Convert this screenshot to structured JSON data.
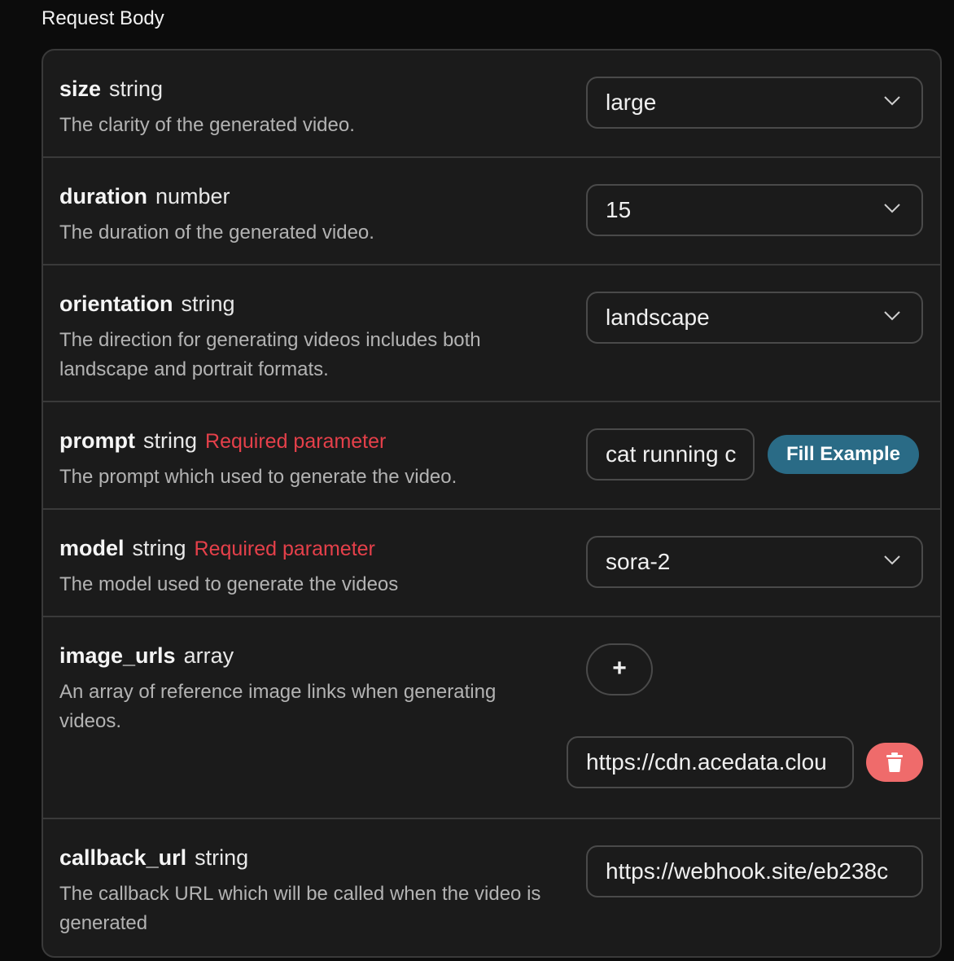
{
  "section_title": "Request Body",
  "colors": {
    "required": "#e5404a",
    "fill_button": "#2a6b86",
    "delete_button": "#ef6b6b"
  },
  "params": [
    {
      "name": "size",
      "type": "string",
      "required_label": "",
      "description": "The clarity of the generated video.",
      "control": "select",
      "value": "large",
      "icon": "chevron-down-icon"
    },
    {
      "name": "duration",
      "type": "number",
      "required_label": "",
      "description": "The duration of the generated video.",
      "control": "select",
      "value": "15",
      "icon": "chevron-down-icon"
    },
    {
      "name": "orientation",
      "type": "string",
      "required_label": "",
      "description": "The direction for generating videos includes both landscape and portrait formats.",
      "control": "select",
      "value": "landscape",
      "icon": "chevron-down-icon"
    },
    {
      "name": "prompt",
      "type": "string",
      "required_label": "Required parameter",
      "description": "The prompt which used to generate the video.",
      "control": "text",
      "value": "cat running c",
      "fill_button_label": "Fill Example"
    },
    {
      "name": "model",
      "type": "string",
      "required_label": "Required parameter",
      "description": "The model used to generate the videos",
      "control": "select",
      "value": "sora-2",
      "icon": "chevron-down-icon"
    },
    {
      "name": "image_urls",
      "type": "array",
      "required_label": "",
      "description": "An array of reference image links when generating videos.",
      "control": "array",
      "add_label": "+",
      "items": [
        "https://cdn.acedata.clou"
      ],
      "icon": "trash-icon"
    },
    {
      "name": "callback_url",
      "type": "string",
      "required_label": "",
      "description": "The callback URL which will be called when the video is generated",
      "control": "text",
      "value": "https://webhook.site/eb238c"
    }
  ]
}
